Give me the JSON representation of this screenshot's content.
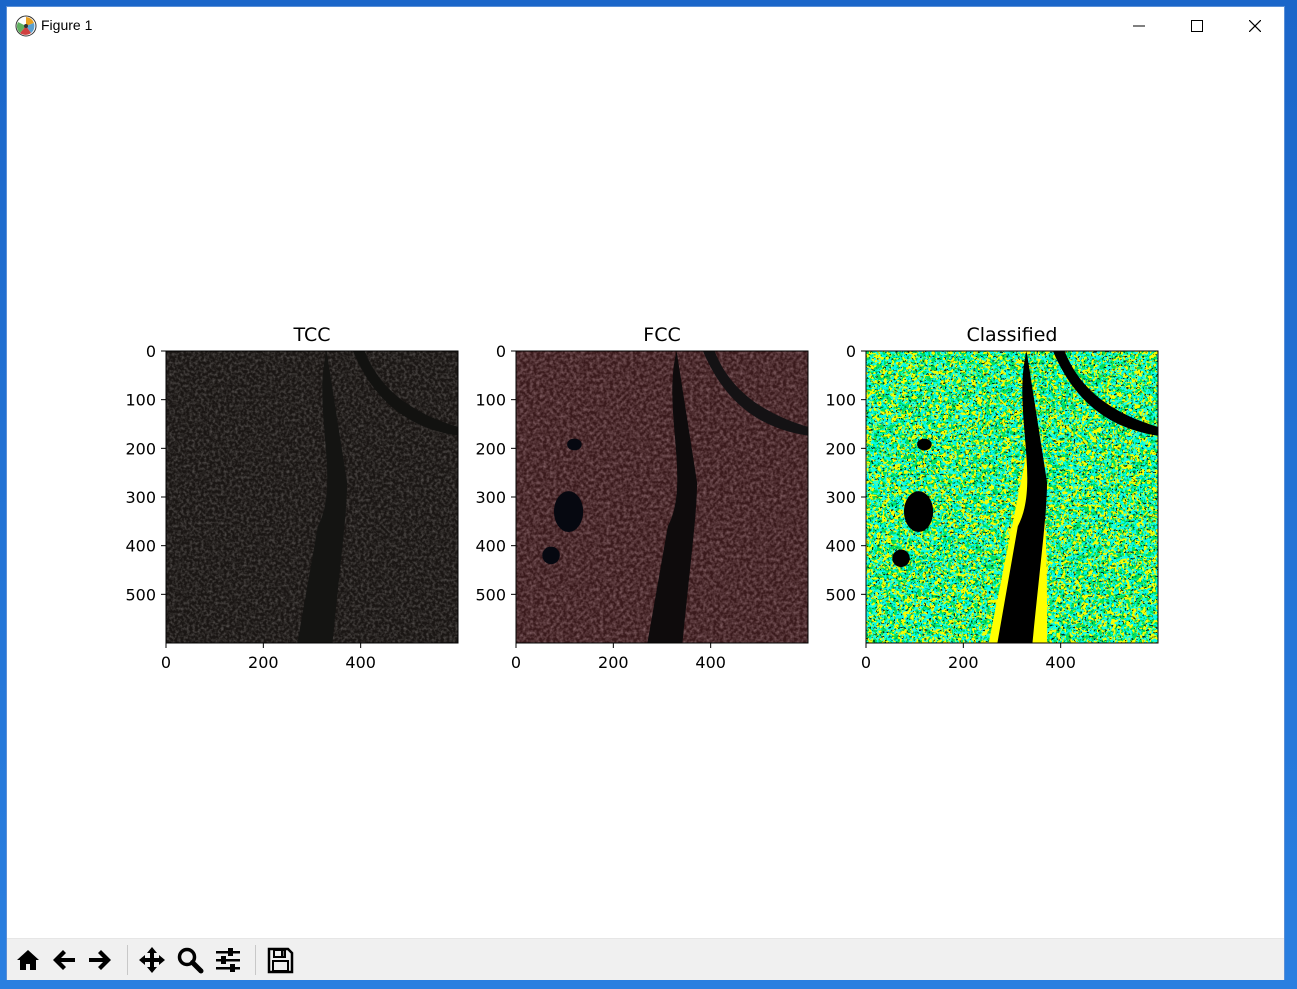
{
  "window": {
    "title": "Figure 1"
  },
  "figure": {
    "panels": [
      {
        "title": "TCC",
        "yticks": [
          "0",
          "100",
          "200",
          "300",
          "400",
          "500"
        ],
        "xticks": [
          "0",
          "200",
          "400"
        ]
      },
      {
        "title": "FCC",
        "yticks": [
          "0",
          "100",
          "200",
          "300",
          "400",
          "500"
        ],
        "xticks": [
          "0",
          "200",
          "400"
        ]
      },
      {
        "title": "Classified",
        "yticks": [
          "0",
          "100",
          "200",
          "300",
          "400",
          "500"
        ],
        "xticks": [
          "0",
          "200",
          "400"
        ]
      }
    ],
    "ytick_values": [
      0,
      100,
      200,
      300,
      400,
      500
    ],
    "xtick_values": [
      0,
      200,
      400
    ],
    "image_extent": [
      600,
      600
    ]
  },
  "toolbar": {
    "buttons": [
      {
        "name": "home-button",
        "icon": "home-icon"
      },
      {
        "name": "back-button",
        "icon": "arrow-left-icon"
      },
      {
        "name": "forward-button",
        "icon": "arrow-right-icon"
      },
      {
        "name": "pan-button",
        "icon": "move-icon"
      },
      {
        "name": "zoom-button",
        "icon": "magnifier-icon"
      },
      {
        "name": "configure-subplots-button",
        "icon": "sliders-icon"
      },
      {
        "name": "save-button",
        "icon": "floppy-disk-icon"
      }
    ]
  },
  "colors": {
    "tcc_base": "#1a1614",
    "fcc_base": "#3a1a1c",
    "class_yellow": "#ffff00",
    "class_green": "#00e060",
    "class_cyan": "#00ffff",
    "class_black": "#000000"
  }
}
